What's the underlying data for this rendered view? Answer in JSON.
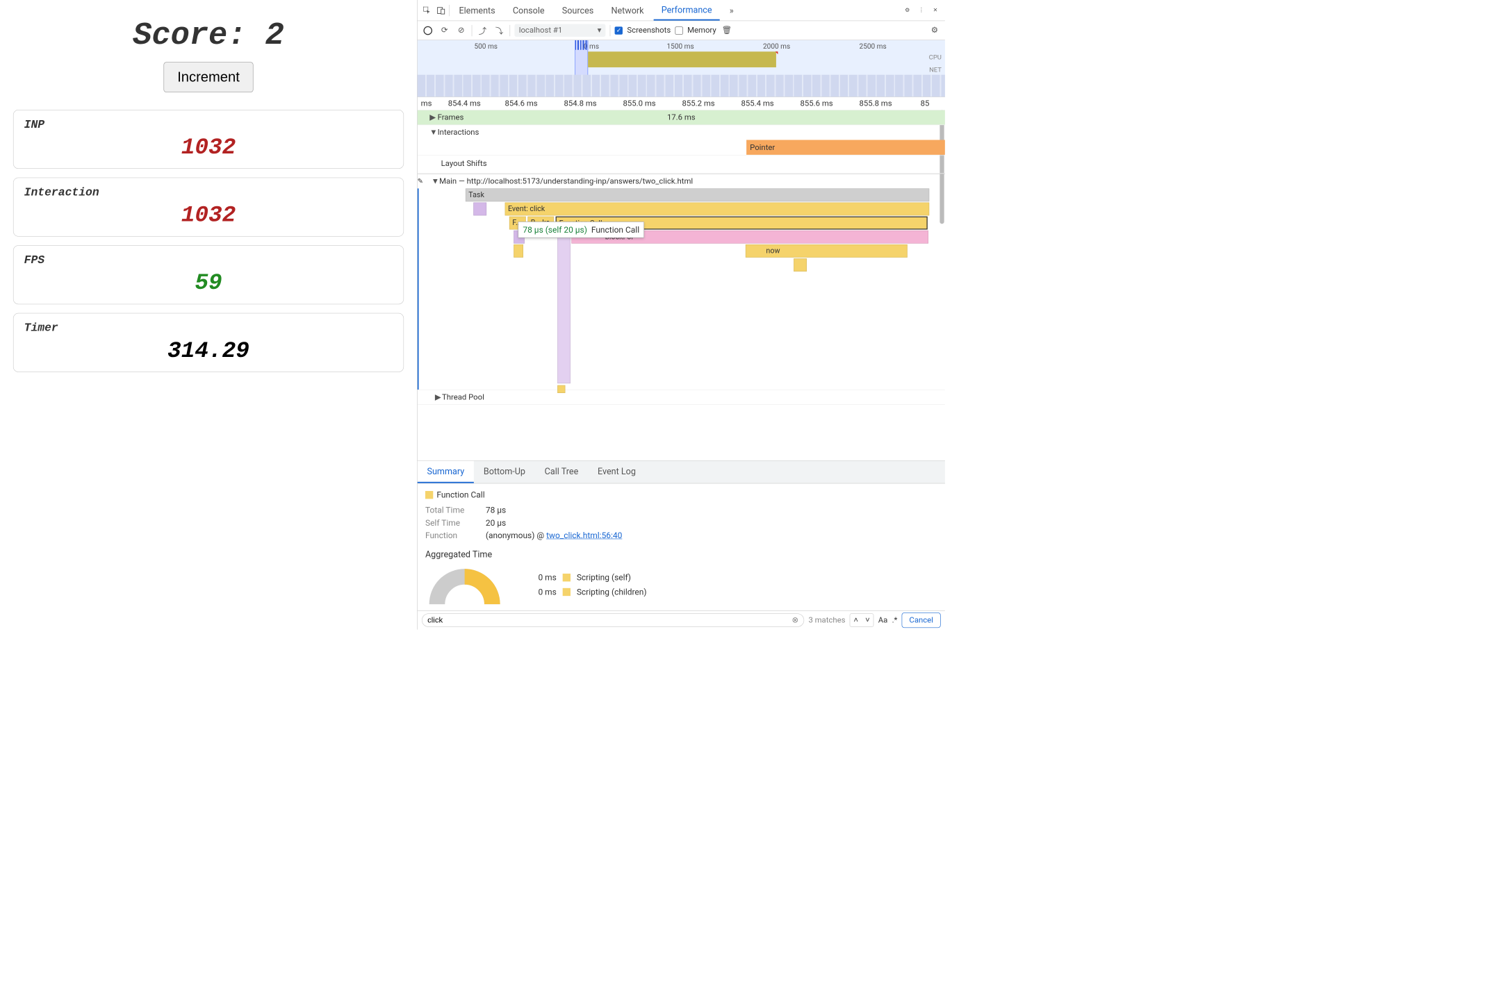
{
  "left": {
    "score_label": "Score:",
    "score_value": "2",
    "increment_label": "Increment",
    "metrics": {
      "inp": {
        "label": "INP",
        "value": "1032"
      },
      "interaction": {
        "label": "Interaction",
        "value": "1032"
      },
      "fps": {
        "label": "FPS",
        "value": "59"
      },
      "timer": {
        "label": "Timer",
        "value": "314.29"
      }
    }
  },
  "devtools": {
    "tabs": [
      "Elements",
      "Console",
      "Sources",
      "Network",
      "Performance"
    ],
    "active_tab": "Performance",
    "more_indicator": "»",
    "toolbar": {
      "session": "localhost #1",
      "screenshots": "Screenshots",
      "memory": "Memory"
    },
    "overview": {
      "ticks": [
        "500 ms",
        "0 ms",
        "1500 ms",
        "2000 ms",
        "2500 ms"
      ],
      "cpu": "CPU",
      "net": "NET"
    },
    "timeline_ruler": [
      "ms",
      "854.4 ms",
      "854.6 ms",
      "854.8 ms",
      "855.0 ms",
      "855.2 ms",
      "855.4 ms",
      "855.6 ms",
      "855.8 ms",
      "85"
    ],
    "tracks": {
      "frames": {
        "label": "Frames",
        "value": "17.6 ms"
      },
      "interactions": {
        "label": "Interactions",
        "pointer": "Pointer"
      },
      "layout_shifts": "Layout Shifts",
      "main": {
        "label": "Main — http://localhost:5173/understanding-inp/answers/two_click.html",
        "task": "Task",
        "event_click": "Event: click",
        "fc1": "F…",
        "fc2": "B… ks",
        "fc3": "Function Call",
        "blockfor": "blockFor",
        "now": "now"
      },
      "thread_pool": "Thread Pool",
      "tooltip": {
        "time": "78 µs (self 20 µs)",
        "name": "Function Call"
      }
    },
    "summary": {
      "tabs": [
        "Summary",
        "Bottom-Up",
        "Call Tree",
        "Event Log"
      ],
      "active": "Summary",
      "title": "Function Call",
      "total_time_k": "Total Time",
      "total_time_v": "78 µs",
      "self_time_k": "Self Time",
      "self_time_v": "20 µs",
      "function_k": "Function",
      "function_v": "(anonymous) @",
      "function_link": "two_click.html:56:40",
      "agg_title": "Aggregated Time",
      "agg_rows": [
        {
          "time": "0 ms",
          "label": "Scripting (self)"
        },
        {
          "time": "0 ms",
          "label": "Scripting (children)"
        }
      ]
    },
    "search": {
      "value": "click",
      "matches": "3 matches",
      "aa": "Aa",
      "regex": ".*",
      "cancel": "Cancel"
    }
  }
}
